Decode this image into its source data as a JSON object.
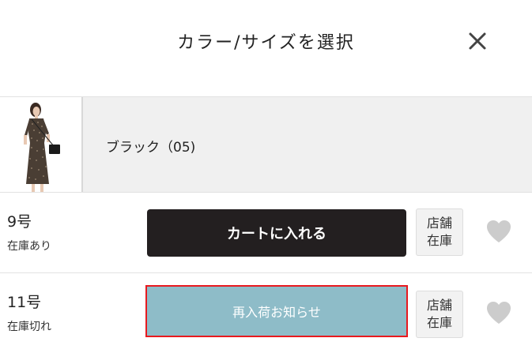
{
  "header": {
    "title": "カラー/サイズを選択",
    "close_icon": "close-icon"
  },
  "color": {
    "label": "ブラック（05)",
    "thumbnail": "product-thumbnail"
  },
  "sizes": [
    {
      "size": "9号",
      "status": "在庫あり",
      "action_label": "カートに入れる",
      "store_label_line1": "店舗",
      "store_label_line2": "在庫",
      "favorite_icon": "heart-icon"
    },
    {
      "size": "11号",
      "status": "在庫切れ",
      "action_label": "再入荷お知らせ",
      "store_label_line1": "店舗",
      "store_label_line2": "在庫",
      "favorite_icon": "heart-icon"
    }
  ],
  "colors": {
    "cart_button_bg": "#231f20",
    "notify_button_bg": "#8ebcc8",
    "highlight_border": "#e8191f",
    "color_row_bg": "#f0f0f0",
    "heart_icon": "#cccccc"
  }
}
